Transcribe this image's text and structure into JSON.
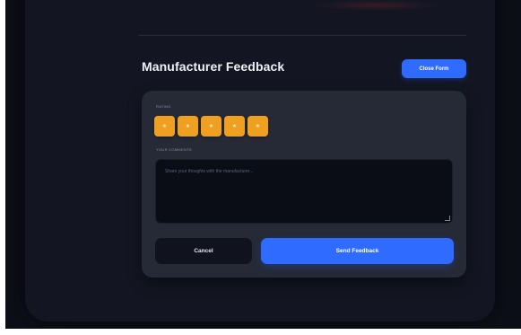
{
  "header": {
    "title": "Manufacturer Feedback",
    "close_label": "Close Form"
  },
  "form": {
    "rating_label": "RATING",
    "stars": [
      {
        "glyph": "★"
      },
      {
        "glyph": "★"
      },
      {
        "glyph": "★"
      },
      {
        "glyph": "★"
      },
      {
        "glyph": "★"
      }
    ],
    "rating_value": 5,
    "rating_max": 5,
    "comments_label": "YOUR COMMENTS",
    "comments_placeholder": "Share your thoughts with the manufacturer...",
    "comments_value": "",
    "cancel_label": "Cancel",
    "send_label": "Send Feedback"
  },
  "colors": {
    "accent": "#2f6bff",
    "star": "#f0a020",
    "card": "#262a36",
    "panel": "#131622",
    "background": "#0d0f18"
  },
  "icons": {
    "star": "star-icon",
    "resize": "resize-handle-icon"
  }
}
